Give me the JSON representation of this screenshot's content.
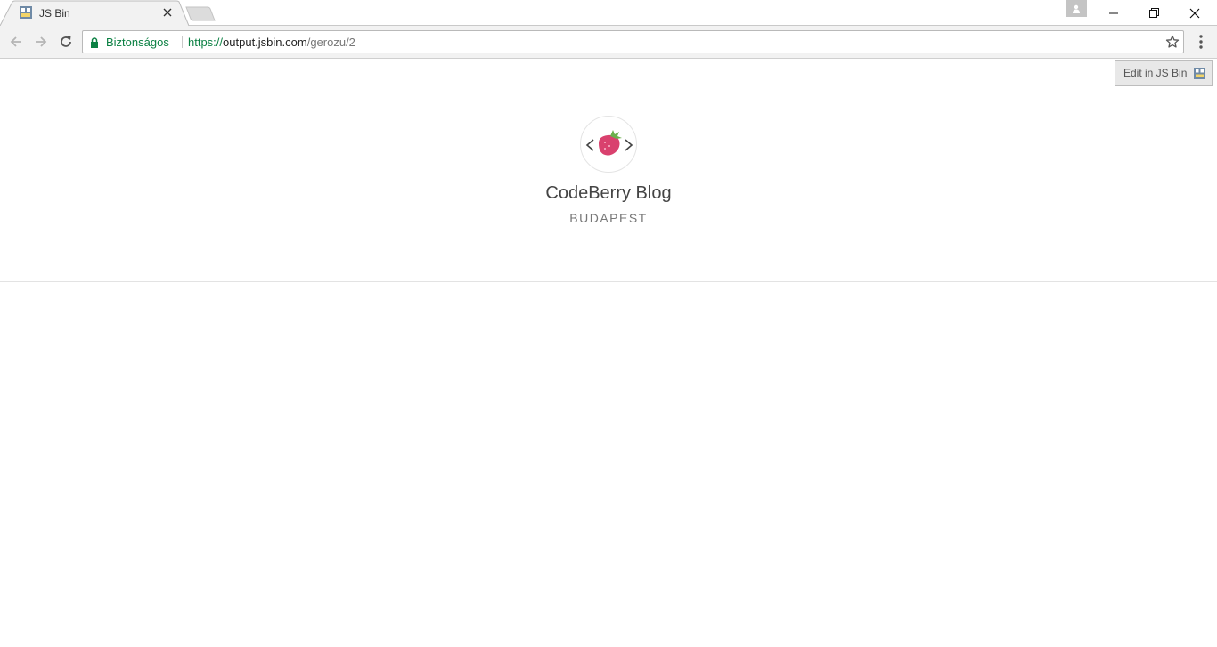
{
  "browser": {
    "tab": {
      "title": "JS Bin",
      "favicon": "jsbin-favicon-icon",
      "close_icon": "close-icon"
    },
    "new_tab_icon": "new-tab-icon",
    "window_controls": [
      "minimize-icon",
      "restore-icon",
      "close-window-icon"
    ],
    "profile_icon": "profile-icon",
    "toolbar": {
      "back_icon": "back-arrow-icon",
      "forward_icon": "forward-arrow-icon",
      "reload_icon": "reload-icon",
      "security_label": "Biztonságos",
      "url_scheme": "https://",
      "url_host": "output.jsbin.com",
      "url_path": "/gerozu/2",
      "bookmark_icon": "star-icon",
      "menu_icon": "more-vert-icon"
    },
    "colors": {
      "secure": "#0b8043",
      "tab_bg": "#f2f2f2",
      "toolbar_bg": "#f2f2f2"
    }
  },
  "page": {
    "edit_button_label": "Edit in JS Bin",
    "logo_icon": "codeberry-logo-icon",
    "title": "CodeBerry Blog",
    "subtitle": "BUDAPEST",
    "colors": {
      "berry": "#d9416e",
      "leaf": "#6ab04c",
      "title": "#444444",
      "subtitle": "#777777"
    }
  }
}
